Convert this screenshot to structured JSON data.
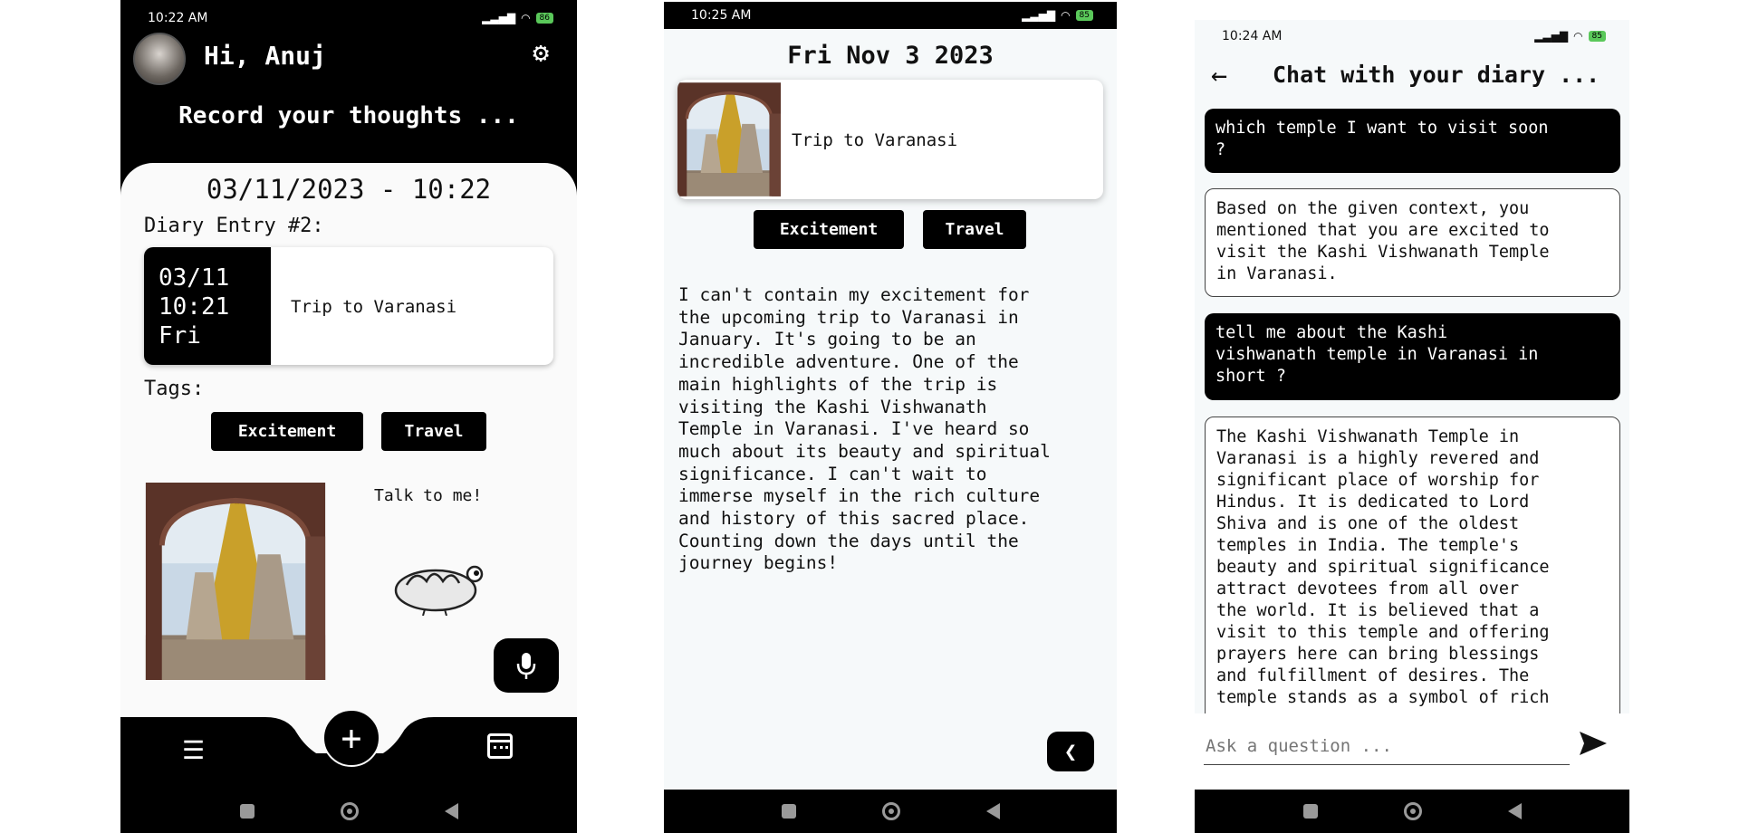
{
  "screen1": {
    "status_time": "10:22 AM",
    "battery": "86",
    "greeting": "Hi, Anuj",
    "banner": "Record your thoughts ...",
    "datetime": "03/11/2023 - 10:22",
    "entry_label": "Diary Entry #2:",
    "entry_card": {
      "date": "03/11",
      "time": "10:21",
      "day": "Fri",
      "title": "Trip to Varanasi"
    },
    "tags_label": "Tags:",
    "tags": [
      "Excitement",
      "Travel"
    ],
    "talk_label": "Talk to me!"
  },
  "screen2": {
    "status_time": "10:25 AM",
    "battery": "85",
    "date_title": "Fri Nov 3 2023",
    "card_title": "Trip to Varanasi",
    "tags": [
      "Excitement",
      "Travel"
    ],
    "body": "I can't contain my excitement for\nthe upcoming trip to Varanasi in\nJanuary. It's going to be an\nincredible adventure. One of the\nmain highlights of the trip is\nvisiting the Kashi Vishwanath\nTemple in Varanasi. I've heard so\nmuch about its beauty and spiritual\nsignificance. I can't wait to\nimmerse myself in the rich culture\nand history of this sacred place.\nCounting down the days until the\njourney begins!"
  },
  "screen3": {
    "status_time": "10:24 AM",
    "battery": "85",
    "title": "Chat with your diary ...",
    "messages": [
      {
        "role": "user",
        "text": "which temple I want to visit soon\n?"
      },
      {
        "role": "bot",
        "text": "Based on the given context, you\nmentioned that you are excited to\nvisit the Kashi Vishwanath Temple\nin Varanasi."
      },
      {
        "role": "user",
        "text": "tell me about the Kashi\nvishwanath temple in Varanasi in\nshort ?"
      },
      {
        "role": "bot",
        "text": "The Kashi Vishwanath Temple in\nVaranasi is a highly revered and\nsignificant place of worship for\nHindus. It is dedicated to Lord\nShiva and is one of the oldest\ntemples in India. The temple's\nbeauty and spiritual significance\nattract devotees from all over\nthe world. It is believed that a\nvisit to this temple and offering\nprayers here can bring blessings\nand fulfillment of desires. The\ntemple stands as a symbol of rich"
      }
    ],
    "input_placeholder": "Ask a question ..."
  }
}
